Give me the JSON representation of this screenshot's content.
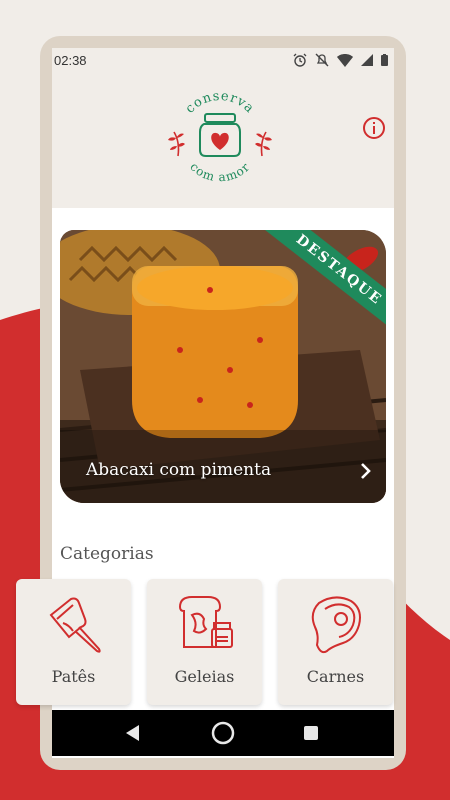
{
  "status_bar": {
    "time": "02:38"
  },
  "logo": {
    "top_text": "conserva",
    "bottom_text": "com amor"
  },
  "featured": {
    "badge": "DESTAQUE",
    "title": "Abacaxi com pimenta"
  },
  "categories": {
    "heading": "Categorias",
    "items": [
      {
        "label": "Patês",
        "icon": "pate-knife-icon"
      },
      {
        "label": "Geleias",
        "icon": "bread-jam-icon"
      },
      {
        "label": "Carnes",
        "icon": "steak-icon"
      }
    ]
  },
  "colors": {
    "brand_red": "#d12e2e",
    "brand_green": "#1f8a5c",
    "background": "#f1ede8"
  }
}
